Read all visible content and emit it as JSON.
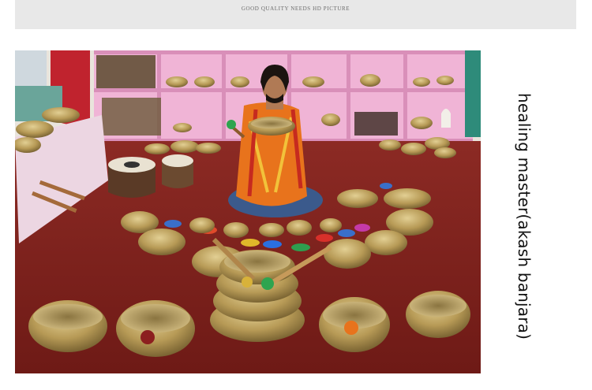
{
  "banner": {
    "text": "GOOD QUALITY NEEDS HD PICTURE"
  },
  "caption": {
    "text": "healing master(akash banjara)"
  },
  "photo": {
    "subject": "man-seated-among-singing-bowls"
  },
  "colors": {
    "banner_bg": "#e8e8e8",
    "carpet": "#7a1f1a",
    "shelves": "#f0b4d6",
    "brass": "#b79a56",
    "shawl": "#e8731c",
    "jeans": "#3b5a8c"
  }
}
